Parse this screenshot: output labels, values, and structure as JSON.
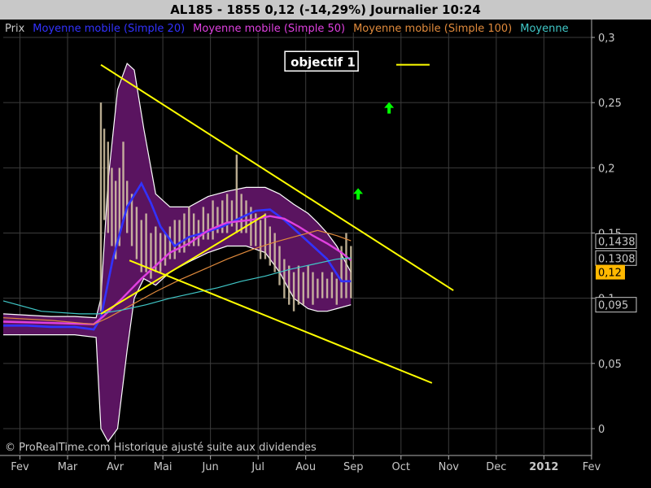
{
  "window": {
    "title": "AL185 - 1855     0,12 (-14,29%)    Journalier  10:24"
  },
  "legend": [
    {
      "label": "Prix",
      "color": "#c8c8c8"
    },
    {
      "label": "Moyenne mobile (Simple 20)",
      "color": "#3232ff"
    },
    {
      "label": "Moyenne mobile (Simple 50)",
      "color": "#e040e0"
    },
    {
      "label": "Moyenne mobile (Simple 100)",
      "color": "#e08a3c"
    },
    {
      "label": "Moyenne",
      "color": "#40c8c8"
    }
  ],
  "footer": {
    "copyright": "© ProRealTime.com Historique ajusté suite aux dividendes"
  },
  "annotations": {
    "target_label": "objectif 1"
  },
  "colors": {
    "background": "#000000",
    "axis_panel": "#000000",
    "grid": "#3c3c3c",
    "trendline": "#ffff00",
    "bollinger_fill": "#5a1460",
    "bollinger_edge": "#ffffff",
    "up_arrow": "#00ff00",
    "last_price_badge": "#ffb800"
  },
  "chart_data": {
    "type": "line",
    "title": "AL185 - 1855     0,12 (-14,29%)    Journalier  10:24",
    "xlabel": "",
    "ylabel": "",
    "x_tick_labels": [
      "Fev",
      "Mar",
      "Avr",
      "Mai",
      "Jun",
      "Jul",
      "Aou",
      "Sep",
      "Oct",
      "Nov",
      "Dec",
      "2012",
      "Fev"
    ],
    "y_tick_labels": [
      "0",
      "0,05",
      "0,1",
      "0,15",
      "0,2",
      "0,25",
      "0,3"
    ],
    "y_tick_values": [
      0,
      0.05,
      0.1,
      0.15,
      0.2,
      0.25,
      0.3
    ],
    "ylim": [
      -0.005,
      0.305
    ],
    "xlim": [
      0,
      12.3
    ],
    "grid": true,
    "price_labels": [
      {
        "text": "0,1438",
        "value": 0.1438,
        "style": "outline"
      },
      {
        "text": "0.1308",
        "value": 0.1308,
        "style": "outline"
      },
      {
        "text": "0,12",
        "value": 0.12,
        "style": "badge"
      },
      {
        "text": "0,095",
        "value": 0.095,
        "style": "outline"
      }
    ],
    "series": [
      {
        "name": "Moyenne mobile (Simple 20)",
        "color": "#3232ff",
        "x": [
          0,
          0.5,
          1,
          1.5,
          1.9,
          2.05,
          2.3,
          2.6,
          2.9,
          3.1,
          3.3,
          3.6,
          3.9,
          4.2,
          4.6,
          5,
          5.3,
          5.6,
          5.9,
          6.2,
          6.5,
          6.8,
          7.1,
          7.3
        ],
        "y": [
          0.079,
          0.079,
          0.078,
          0.078,
          0.076,
          0.085,
          0.13,
          0.17,
          0.188,
          0.173,
          0.155,
          0.14,
          0.147,
          0.15,
          0.155,
          0.162,
          0.167,
          0.168,
          0.16,
          0.15,
          0.14,
          0.13,
          0.113,
          0.113
        ]
      },
      {
        "name": "Moyenne mobile (Simple 50)",
        "color": "#e040e0",
        "x": [
          0,
          1,
          1.9,
          2.1,
          2.5,
          2.9,
          3.2,
          3.5,
          3.9,
          4.3,
          4.7,
          5.2,
          5.6,
          5.9,
          6.2,
          6.5,
          6.8,
          7.1,
          7.3
        ],
        "y": [
          0.082,
          0.081,
          0.08,
          0.086,
          0.1,
          0.115,
          0.125,
          0.135,
          0.142,
          0.152,
          0.158,
          0.16,
          0.163,
          0.161,
          0.155,
          0.148,
          0.142,
          0.135,
          0.129
        ]
      },
      {
        "name": "Moyenne mobile (Simple 100)",
        "color": "#e08a3c",
        "x": [
          0,
          1,
          1.9,
          2.2,
          2.7,
          3.2,
          3.7,
          4.2,
          4.7,
          5.2,
          5.7,
          6.2,
          6.6,
          7,
          7.3
        ],
        "y": [
          0.085,
          0.083,
          0.08,
          0.085,
          0.095,
          0.105,
          0.114,
          0.122,
          0.13,
          0.137,
          0.143,
          0.148,
          0.152,
          0.148,
          0.144
        ]
      },
      {
        "name": "Moyenne",
        "color": "#40c8c8",
        "x": [
          0,
          0.8,
          1.6,
          2.0,
          2.5,
          3.0,
          3.5,
          4.0,
          4.5,
          5.0,
          5.5,
          6.0,
          6.5,
          7.0,
          7.3
        ],
        "y": [
          0.098,
          0.09,
          0.088,
          0.088,
          0.091,
          0.095,
          0.1,
          0.104,
          0.108,
          0.113,
          0.117,
          0.122,
          0.126,
          0.13,
          0.131
        ]
      }
    ],
    "bollinger": {
      "x": [
        0,
        0.5,
        1,
        1.5,
        1.95,
        2.05,
        2.2,
        2.4,
        2.6,
        2.75,
        2.95,
        3.2,
        3.5,
        3.9,
        4.3,
        4.7,
        5.1,
        5.5,
        5.8,
        6.1,
        6.4,
        6.6,
        6.8,
        7.0,
        7.3
      ],
      "upper": [
        0.088,
        0.087,
        0.086,
        0.086,
        0.085,
        0.1,
        0.19,
        0.26,
        0.28,
        0.275,
        0.23,
        0.18,
        0.17,
        0.17,
        0.178,
        0.182,
        0.185,
        0.185,
        0.18,
        0.172,
        0.165,
        0.158,
        0.15,
        0.14,
        0.12
      ],
      "lower": [
        0.072,
        0.072,
        0.072,
        0.072,
        0.07,
        0.0,
        -0.01,
        0.0,
        0.06,
        0.1,
        0.115,
        0.11,
        0.12,
        0.128,
        0.135,
        0.14,
        0.14,
        0.135,
        0.12,
        0.1,
        0.092,
        0.09,
        0.09,
        0.092,
        0.095
      ]
    },
    "price_bars": [
      {
        "x": 2.05,
        "high": 0.25,
        "low": 0.09
      },
      {
        "x": 2.12,
        "high": 0.23,
        "low": 0.16
      },
      {
        "x": 2.2,
        "high": 0.22,
        "low": 0.15
      },
      {
        "x": 2.28,
        "high": 0.2,
        "low": 0.14
      },
      {
        "x": 2.36,
        "high": 0.19,
        "low": 0.13
      },
      {
        "x": 2.44,
        "high": 0.2,
        "low": 0.14
      },
      {
        "x": 2.52,
        "high": 0.22,
        "low": 0.16
      },
      {
        "x": 2.6,
        "high": 0.19,
        "low": 0.15
      },
      {
        "x": 2.7,
        "high": 0.18,
        "low": 0.14
      },
      {
        "x": 2.8,
        "high": 0.17,
        "low": 0.13
      },
      {
        "x": 2.9,
        "high": 0.16,
        "low": 0.12
      },
      {
        "x": 3.0,
        "high": 0.165,
        "low": 0.12
      },
      {
        "x": 3.1,
        "high": 0.15,
        "low": 0.115
      },
      {
        "x": 3.2,
        "high": 0.155,
        "low": 0.12
      },
      {
        "x": 3.3,
        "high": 0.15,
        "low": 0.12
      },
      {
        "x": 3.4,
        "high": 0.15,
        "low": 0.125
      },
      {
        "x": 3.5,
        "high": 0.155,
        "low": 0.13
      },
      {
        "x": 3.6,
        "high": 0.16,
        "low": 0.13
      },
      {
        "x": 3.7,
        "high": 0.16,
        "low": 0.135
      },
      {
        "x": 3.8,
        "high": 0.165,
        "low": 0.135
      },
      {
        "x": 3.9,
        "high": 0.17,
        "low": 0.14
      },
      {
        "x": 4.0,
        "high": 0.165,
        "low": 0.14
      },
      {
        "x": 4.1,
        "high": 0.16,
        "low": 0.14
      },
      {
        "x": 4.2,
        "high": 0.17,
        "low": 0.145
      },
      {
        "x": 4.3,
        "high": 0.165,
        "low": 0.145
      },
      {
        "x": 4.4,
        "high": 0.175,
        "low": 0.145
      },
      {
        "x": 4.5,
        "high": 0.17,
        "low": 0.15
      },
      {
        "x": 4.6,
        "high": 0.175,
        "low": 0.15
      },
      {
        "x": 4.7,
        "high": 0.18,
        "low": 0.15
      },
      {
        "x": 4.8,
        "high": 0.175,
        "low": 0.155
      },
      {
        "x": 4.9,
        "high": 0.21,
        "low": 0.15
      },
      {
        "x": 5.0,
        "high": 0.18,
        "low": 0.15
      },
      {
        "x": 5.1,
        "high": 0.175,
        "low": 0.15
      },
      {
        "x": 5.2,
        "high": 0.17,
        "low": 0.14
      },
      {
        "x": 5.3,
        "high": 0.165,
        "low": 0.14
      },
      {
        "x": 5.4,
        "high": 0.16,
        "low": 0.13
      },
      {
        "x": 5.5,
        "high": 0.165,
        "low": 0.13
      },
      {
        "x": 5.6,
        "high": 0.155,
        "low": 0.125
      },
      {
        "x": 5.7,
        "high": 0.15,
        "low": 0.12
      },
      {
        "x": 5.8,
        "high": 0.14,
        "low": 0.11
      },
      {
        "x": 5.9,
        "high": 0.13,
        "low": 0.1
      },
      {
        "x": 6.0,
        "high": 0.125,
        "low": 0.095
      },
      {
        "x": 6.1,
        "high": 0.12,
        "low": 0.09
      },
      {
        "x": 6.2,
        "high": 0.125,
        "low": 0.095
      },
      {
        "x": 6.3,
        "high": 0.12,
        "low": 0.095
      },
      {
        "x": 6.4,
        "high": 0.125,
        "low": 0.1
      },
      {
        "x": 6.5,
        "high": 0.12,
        "low": 0.095
      },
      {
        "x": 6.6,
        "high": 0.115,
        "low": 0.1
      },
      {
        "x": 6.7,
        "high": 0.12,
        "low": 0.1
      },
      {
        "x": 6.8,
        "high": 0.115,
        "low": 0.1
      },
      {
        "x": 6.9,
        "high": 0.12,
        "low": 0.1
      },
      {
        "x": 7.0,
        "high": 0.115,
        "low": 0.095
      },
      {
        "x": 7.1,
        "high": 0.14,
        "low": 0.1
      },
      {
        "x": 7.2,
        "high": 0.15,
        "low": 0.1
      },
      {
        "x": 7.3,
        "high": 0.14,
        "low": 0.1
      }
    ],
    "trendlines": [
      {
        "x": [
          2.05,
          9.45
        ],
        "y": [
          0.279,
          0.106
        ]
      },
      {
        "x": [
          2.05,
          5.5
        ],
        "y": [
          0.088,
          0.164
        ]
      },
      {
        "x": [
          2.65,
          9.0
        ],
        "y": [
          0.129,
          0.035
        ]
      },
      {
        "x": [
          8.25,
          8.95
        ],
        "y": [
          0.279,
          0.279
        ]
      }
    ],
    "up_arrows": [
      {
        "x": 8.1,
        "y": 0.246
      },
      {
        "x": 7.45,
        "y": 0.18
      }
    ],
    "target_label_x": 7.45,
    "target_label_y": 0.283
  }
}
